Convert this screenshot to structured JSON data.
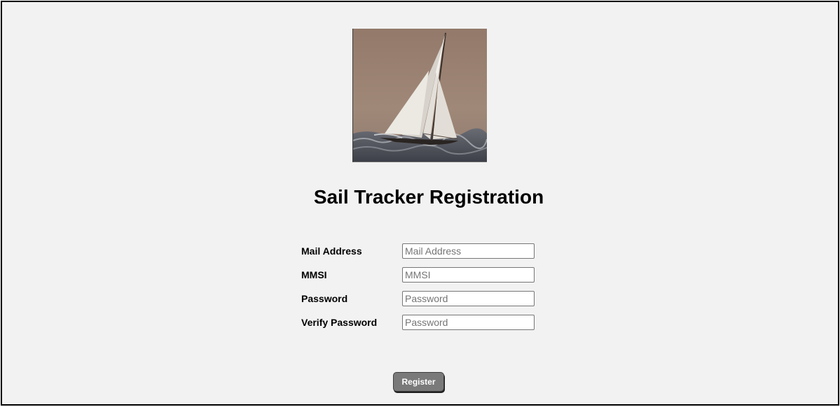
{
  "page": {
    "title": "Sail Tracker Registration"
  },
  "logo": {
    "icon": "sailboat-painting-icon"
  },
  "form": {
    "fields": [
      {
        "label": "Mail Address",
        "placeholder": "Mail Address",
        "value": ""
      },
      {
        "label": "MMSI",
        "placeholder": "MMSI",
        "value": ""
      },
      {
        "label": "Password",
        "placeholder": "Password",
        "value": ""
      },
      {
        "label": "Verify Password",
        "placeholder": "Password",
        "value": ""
      }
    ],
    "submit_label": "Register"
  },
  "colors": {
    "background": "#f2f2f2",
    "frame_border": "#000000",
    "button_bg": "#7a7a7a",
    "button_text": "#ffffff"
  }
}
